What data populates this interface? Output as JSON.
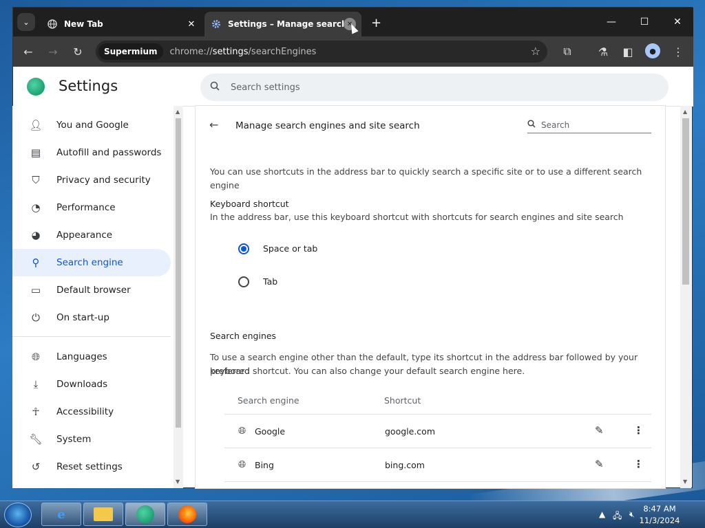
{
  "browser": {
    "tabs": [
      {
        "title": "New Tab",
        "icon": "globe-icon"
      },
      {
        "title": "Settings – Manage search engines",
        "icon": "gear-icon",
        "active": true
      }
    ],
    "address": {
      "chip": "Supermium",
      "url_prefix": "chrome://",
      "url_highlight": "settings",
      "url_rest": "/searchEngines"
    },
    "tab_search_glyph": "⌄",
    "tab_close_glyph": "✕",
    "newtab_glyph": "+",
    "minimize_glyph": "—",
    "maximize_glyph": "☐",
    "close_glyph": "✕"
  },
  "settings": {
    "title": "Settings",
    "search_placeholder": "Search settings",
    "sidebar": [
      {
        "label": "You and Google",
        "icon": "person-icon"
      },
      {
        "label": "Autofill and passwords",
        "icon": "clipboard-icon"
      },
      {
        "label": "Privacy and security",
        "icon": "shield-icon"
      },
      {
        "label": "Performance",
        "icon": "gauge-icon"
      },
      {
        "label": "Appearance",
        "icon": "palette-icon"
      },
      {
        "label": "Search engine",
        "icon": "search-icon",
        "active": true
      },
      {
        "label": "Default browser",
        "icon": "browser-icon"
      },
      {
        "label": "On start-up",
        "icon": "power-icon"
      },
      {
        "label": "Languages",
        "icon": "globe-icon"
      },
      {
        "label": "Downloads",
        "icon": "download-icon"
      },
      {
        "label": "Accessibility",
        "icon": "accessibility-icon"
      },
      {
        "label": "System",
        "icon": "wrench-icon"
      },
      {
        "label": "Reset settings",
        "icon": "history-icon"
      }
    ]
  },
  "main": {
    "page_title": "Manage search engines and site search",
    "search_placeholder": "Search",
    "intro": "You can use shortcuts in the address bar to quickly search a specific site or to use a different search engine",
    "keyboard_heading": "Keyboard shortcut",
    "keyboard_desc": "In the address bar, use this keyboard shortcut with shortcuts for search engines and site search",
    "options": [
      {
        "label": "Space or tab",
        "selected": true
      },
      {
        "label": "Tab",
        "selected": false
      }
    ],
    "engines_heading": "Search engines",
    "engines_desc_line1": "To use a search engine other than the default, type its shortcut in the address bar followed by your preferred",
    "engines_desc_line2": "keyboard shortcut. You can also change your default search engine here.",
    "col_engine": "Search engine",
    "col_shortcut": "Shortcut",
    "engines": [
      {
        "name": "Google",
        "shortcut": "google.com"
      },
      {
        "name": "Bing",
        "shortcut": "bing.com"
      }
    ]
  },
  "taskbar": {
    "time": "8:47 AM",
    "date": "11/3/2024"
  },
  "colors": {
    "accent": "#0b57d0",
    "active_nav_bg": "#e8f0fe",
    "tab_strip": "#1f1f1f"
  }
}
